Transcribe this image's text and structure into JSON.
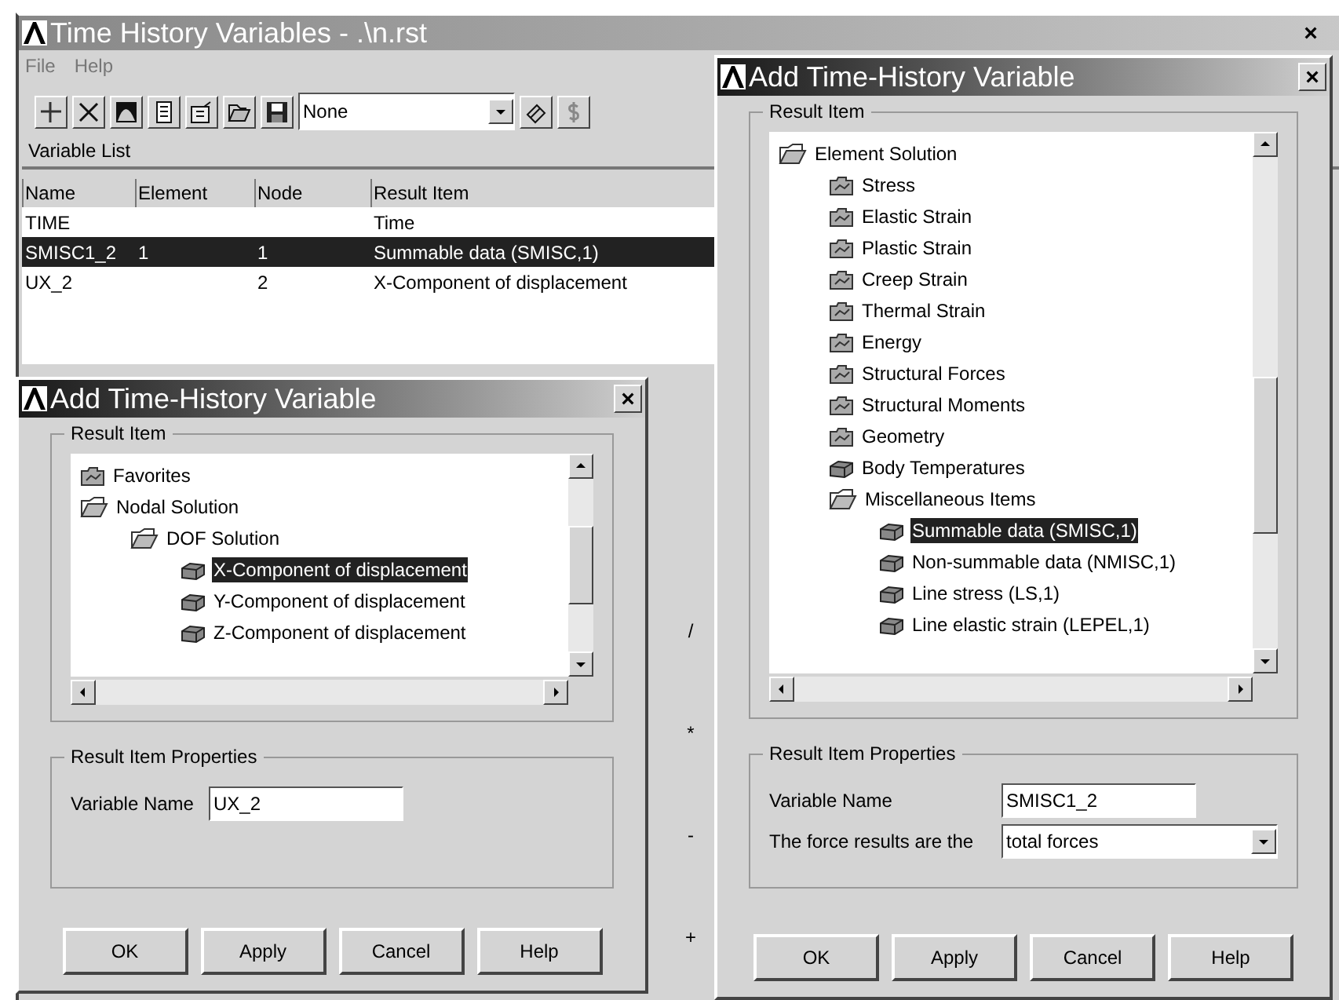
{
  "main_window": {
    "title": "Time History Variables - .\\n.rst",
    "close": "×",
    "menu": [
      "File",
      "Help"
    ],
    "toolbar_select": "None",
    "section": "Variable List",
    "table": {
      "columns": [
        "Name",
        "Element",
        "Node",
        "Result Item"
      ],
      "rows": [
        {
          "cells": [
            "TIME",
            "",
            "",
            "Time"
          ],
          "selected": false
        },
        {
          "cells": [
            "SMISC1_2",
            "1",
            "1",
            "Summable data (SMISC,1)"
          ],
          "selected": true
        },
        {
          "cells": [
            "UX_2",
            "",
            "2",
            "X-Component of displacement"
          ],
          "selected": false
        }
      ]
    },
    "operators": [
      "/",
      "*",
      "-",
      "+"
    ]
  },
  "left_dialog": {
    "title": "Add Time-History Variable",
    "close": "×",
    "group": "Result Item",
    "tree": [
      {
        "label": "Favorites",
        "kind": "folder",
        "selected": false
      },
      {
        "label": "Nodal Solution",
        "kind": "open-folder",
        "selected": false,
        "children": [
          {
            "label": "DOF Solution",
            "kind": "open-folder",
            "selected": false,
            "children": [
              {
                "label": "X-Component of displacement",
                "kind": "item",
                "selected": true
              },
              {
                "label": "Y-Component of displacement",
                "kind": "item",
                "selected": false
              },
              {
                "label": "Z-Component of displacement",
                "kind": "item",
                "selected": false
              }
            ]
          }
        ]
      }
    ],
    "properties": "Result Item Properties",
    "fields": [
      {
        "kind": "text",
        "label": "Variable Name",
        "value": "UX_2"
      }
    ],
    "buttons": [
      "OK",
      "Apply",
      "Cancel",
      "Help"
    ]
  },
  "right_dialog": {
    "title": "Add Time-History Variable",
    "close": "×",
    "group": "Result Item",
    "tree": [
      {
        "label": "Element Solution",
        "kind": "open-folder",
        "selected": false,
        "children": [
          {
            "label": "Stress",
            "kind": "folder",
            "selected": false
          },
          {
            "label": "Elastic Strain",
            "kind": "folder",
            "selected": false
          },
          {
            "label": "Plastic Strain",
            "kind": "folder",
            "selected": false
          },
          {
            "label": "Creep Strain",
            "kind": "folder",
            "selected": false
          },
          {
            "label": "Thermal Strain",
            "kind": "folder",
            "selected": false
          },
          {
            "label": "Energy",
            "kind": "folder",
            "selected": false
          },
          {
            "label": "Structural Forces",
            "kind": "folder",
            "selected": false
          },
          {
            "label": "Structural Moments",
            "kind": "folder",
            "selected": false
          },
          {
            "label": "Geometry",
            "kind": "folder",
            "selected": false
          },
          {
            "label": "Body Temperatures",
            "kind": "item",
            "selected": false
          },
          {
            "label": "Miscellaneous Items",
            "kind": "open-folder",
            "selected": false,
            "children": [
              {
                "label": "Summable data (SMISC,1)",
                "kind": "item",
                "selected": true
              },
              {
                "label": "Non-summable data (NMISC,1)",
                "kind": "item",
                "selected": false
              },
              {
                "label": "Line stress (LS,1)",
                "kind": "item",
                "selected": false
              },
              {
                "label": "Line elastic strain (LEPEL,1)",
                "kind": "item",
                "selected": false
              }
            ]
          }
        ]
      }
    ],
    "properties": "Result Item Properties",
    "fields": [
      {
        "kind": "text",
        "label": "Variable Name",
        "value": "SMISC1_2"
      },
      {
        "kind": "select",
        "label": "The force results are the",
        "value": "total forces"
      }
    ],
    "buttons": [
      "OK",
      "Apply",
      "Cancel",
      "Help"
    ]
  }
}
